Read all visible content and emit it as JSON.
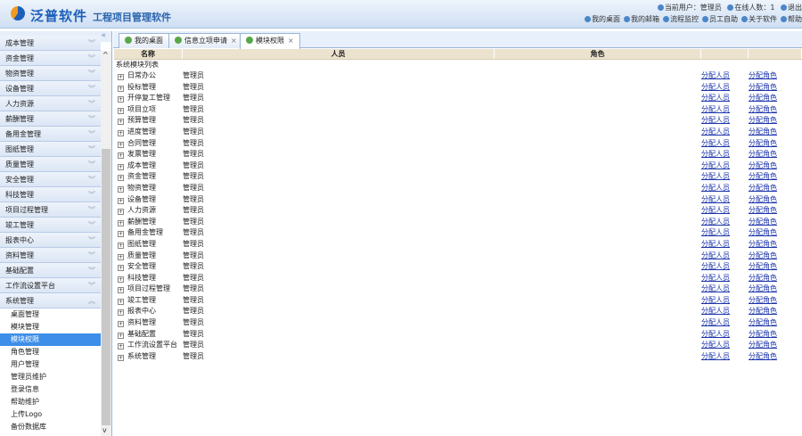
{
  "header": {
    "brand": "泛普软件",
    "app_title": "工程项目管理软件",
    "current_user_label": "当前用户：管理员",
    "online_label": "在线人数：1",
    "logout": "退出",
    "links": [
      "我的桌面",
      "我的邮箱",
      "流程监控",
      "员工自助",
      "关于软件",
      "帮助"
    ]
  },
  "sidebar": {
    "collapse": "«",
    "groups": [
      "成本管理",
      "资金管理",
      "物资管理",
      "设备管理",
      "人力资源",
      "薪酬管理",
      "备用金管理",
      "图纸管理",
      "质量管理",
      "安全管理",
      "科技管理",
      "项目过程管理",
      "竣工管理",
      "报表中心",
      "资料管理",
      "基础配置",
      "工作流设置平台",
      "系统管理"
    ],
    "subitems": [
      "桌面管理",
      "模块管理",
      "模块权限",
      "角色管理",
      "用户管理",
      "管理员维护",
      "登录信息",
      "帮助维护",
      "上传Logo",
      "备份数据库"
    ],
    "selected": "模块权限"
  },
  "tabs": [
    {
      "label": "我的桌面",
      "closable": false
    },
    {
      "label": "信息立项申请",
      "closable": true
    },
    {
      "label": "模块权限",
      "closable": true
    }
  ],
  "table": {
    "columns": [
      "名称",
      "人员",
      "角色",
      "",
      ""
    ],
    "caption": "系统模块列表",
    "assign_user": "分配人员",
    "assign_role": "分配角色",
    "rows": [
      {
        "name": "日常办公",
        "user": "管理员"
      },
      {
        "name": "投标管理",
        "user": "管理员"
      },
      {
        "name": "开停复工管理",
        "user": "管理员"
      },
      {
        "name": "项目立项",
        "user": "管理员"
      },
      {
        "name": "预算管理",
        "user": "管理员"
      },
      {
        "name": "进度管理",
        "user": "管理员"
      },
      {
        "name": "合同管理",
        "user": "管理员"
      },
      {
        "name": "发票管理",
        "user": "管理员"
      },
      {
        "name": "成本管理",
        "user": "管理员"
      },
      {
        "name": "资金管理",
        "user": "管理员"
      },
      {
        "name": "物资管理",
        "user": "管理员"
      },
      {
        "name": "设备管理",
        "user": "管理员"
      },
      {
        "name": "人力资源",
        "user": "管理员"
      },
      {
        "name": "薪酬管理",
        "user": "管理员"
      },
      {
        "name": "备用金管理",
        "user": "管理员"
      },
      {
        "name": "图纸管理",
        "user": "管理员"
      },
      {
        "name": "质量管理",
        "user": "管理员"
      },
      {
        "name": "安全管理",
        "user": "管理员"
      },
      {
        "name": "科技管理",
        "user": "管理员"
      },
      {
        "name": "项目过程管理",
        "user": "管理员"
      },
      {
        "name": "竣工管理",
        "user": "管理员"
      },
      {
        "name": "报表中心",
        "user": "管理员"
      },
      {
        "name": "资料管理",
        "user": "管理员"
      },
      {
        "name": "基础配置",
        "user": "管理员"
      },
      {
        "name": "工作流设置平台",
        "user": "管理员"
      },
      {
        "name": "系统管理",
        "user": "管理员"
      }
    ]
  }
}
